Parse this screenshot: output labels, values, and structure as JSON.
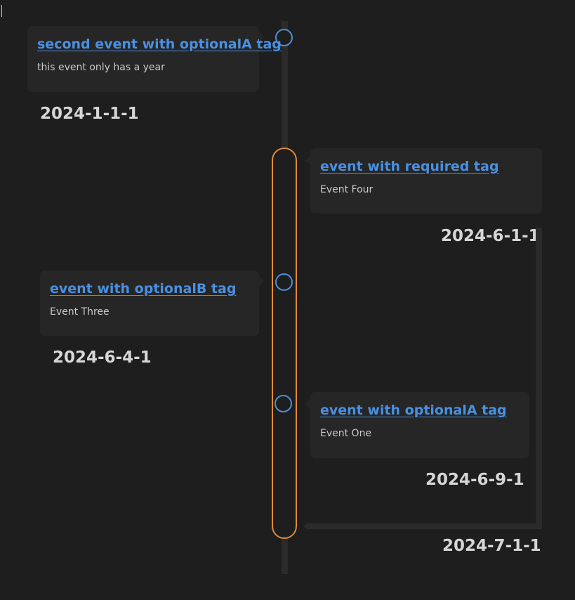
{
  "events": [
    {
      "title": "second event with optionalA tag",
      "description": "this event only has a year",
      "date": "2024-1-1-1"
    },
    {
      "title": "event with required tag",
      "description": "Event Four",
      "date": "2024-6-1-1",
      "end_date": "2024-7-1-1"
    },
    {
      "title": "event with optionalB tag",
      "description": "Event Three",
      "date": "2024-6-4-1"
    },
    {
      "title": "event with optionalA tag",
      "description": "Event One",
      "date": "2024-6-9-1"
    }
  ],
  "colors": {
    "background": "#1e1e1e",
    "card": "#262626",
    "link": "#4a90e2",
    "marker": "#4a8fd9",
    "range": "#e18a36",
    "axis": "#2b2b2b"
  }
}
